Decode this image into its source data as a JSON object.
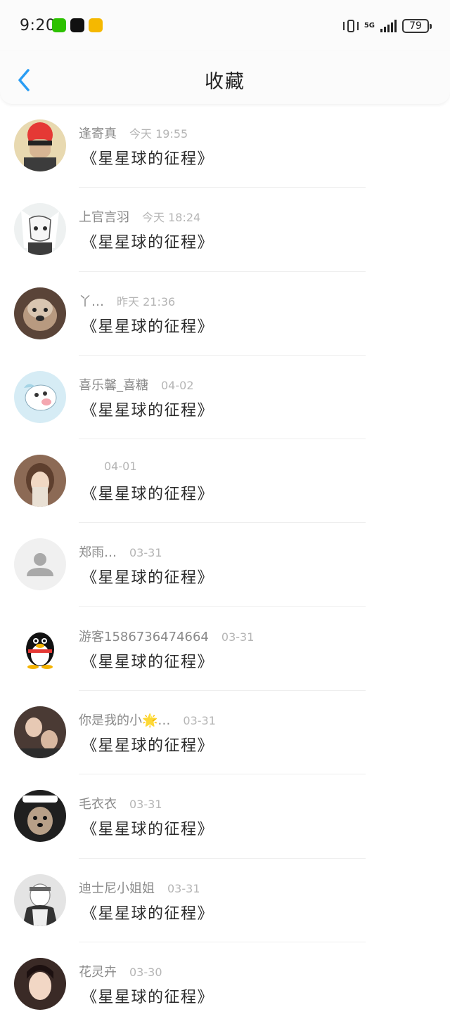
{
  "status": {
    "time": "9:20",
    "network": "5G",
    "battery": "79"
  },
  "nav": {
    "title": "收藏",
    "back_icon": "chevron-left-icon"
  },
  "items": [
    {
      "name": "逢寄真",
      "time": "今天 19:55",
      "book": "《星星球的征程》"
    },
    {
      "name": "上官言羽",
      "time": "今天 18:24",
      "book": "《星星球的征程》"
    },
    {
      "name": "丫…",
      "time": "昨天 21:36",
      "book": "《星星球的征程》"
    },
    {
      "name": "喜乐馨_喜糖",
      "time": "04-02",
      "book": "《星星球的征程》"
    },
    {
      "name": "",
      "time": "04-01",
      "book": "《星星球的征程》"
    },
    {
      "name": "郑雨…",
      "time": "03-31",
      "book": "《星星球的征程》"
    },
    {
      "name": "游客1586736474664",
      "time": "03-31",
      "book": "《星星球的征程》"
    },
    {
      "name": "你是我的小🌟…",
      "time": "03-31",
      "book": "《星星球的征程》"
    },
    {
      "name": "毛衣衣",
      "time": "03-31",
      "book": "《星星球的征程》"
    },
    {
      "name": "迪士尼小姐姐",
      "time": "03-31",
      "book": "《星星球的征程》"
    },
    {
      "name": "花灵卉",
      "time": "03-30",
      "book": "《星星球的征程》"
    }
  ]
}
